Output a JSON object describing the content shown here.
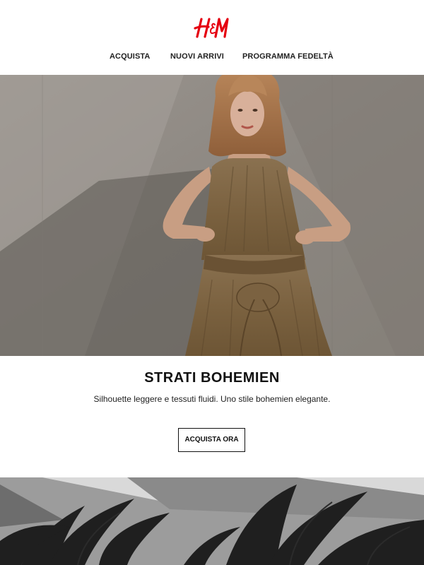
{
  "brand": {
    "logo_text": "H&M",
    "logo_color": "#e50010"
  },
  "nav": {
    "items": [
      {
        "label": "ACQUISTA"
      },
      {
        "label": "NUOVI ARRIVI"
      },
      {
        "label": "PROGRAMMA FEDELTÀ"
      }
    ]
  },
  "hero": {
    "image_subject": "model-in-brown-dress"
  },
  "promo": {
    "title": "STRATI BOHEMIEN",
    "subtitle": "Silhouette leggere e tessuti fluidi. Uno stile bohemien elegante.",
    "cta_label": "ACQUISTA ORA"
  },
  "second_banner": {
    "image_subject": "palm-trees-black-and-white"
  }
}
